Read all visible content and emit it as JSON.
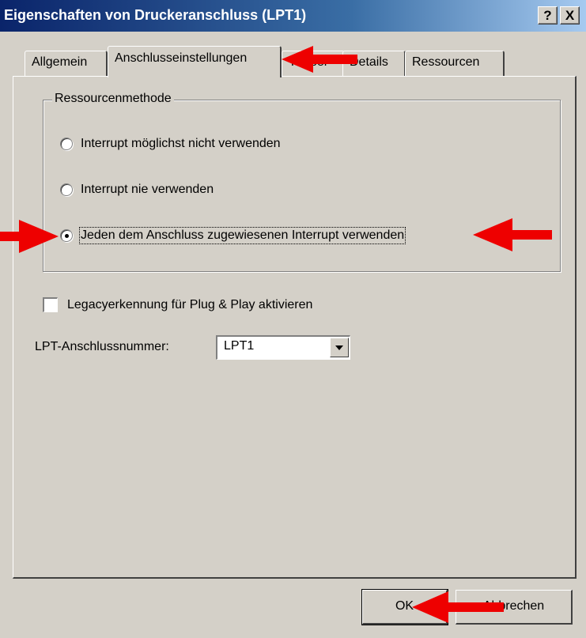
{
  "window": {
    "title": "Eigenschaften von Druckeranschluss (LPT1)",
    "help_button": "?",
    "close_button": "X"
  },
  "tabs": [
    {
      "label": "Allgemein",
      "active": false
    },
    {
      "label": "Anschlusseinstellungen",
      "active": true
    },
    {
      "label": "Treiber",
      "active": false
    },
    {
      "label": "Details",
      "active": false
    },
    {
      "label": "Ressourcen",
      "active": false
    }
  ],
  "resources_group": {
    "legend": "Ressourcenmethode",
    "options": [
      {
        "label": "Interrupt möglichst nicht verwenden",
        "selected": false
      },
      {
        "label": "Interrupt nie verwenden",
        "selected": false
      },
      {
        "label": "Jeden dem Anschluss zugewiesenen Interrupt verwenden",
        "selected": true
      }
    ]
  },
  "legacy_checkbox": {
    "label": "Legacyerkennung für Plug & Play aktivieren",
    "checked": false
  },
  "lpt_number": {
    "label": "LPT-Anschlussnummer:",
    "value": "LPT1"
  },
  "buttons": {
    "ok": "OK",
    "cancel": "Abbrechen"
  },
  "annotation_color": "#ee0000"
}
